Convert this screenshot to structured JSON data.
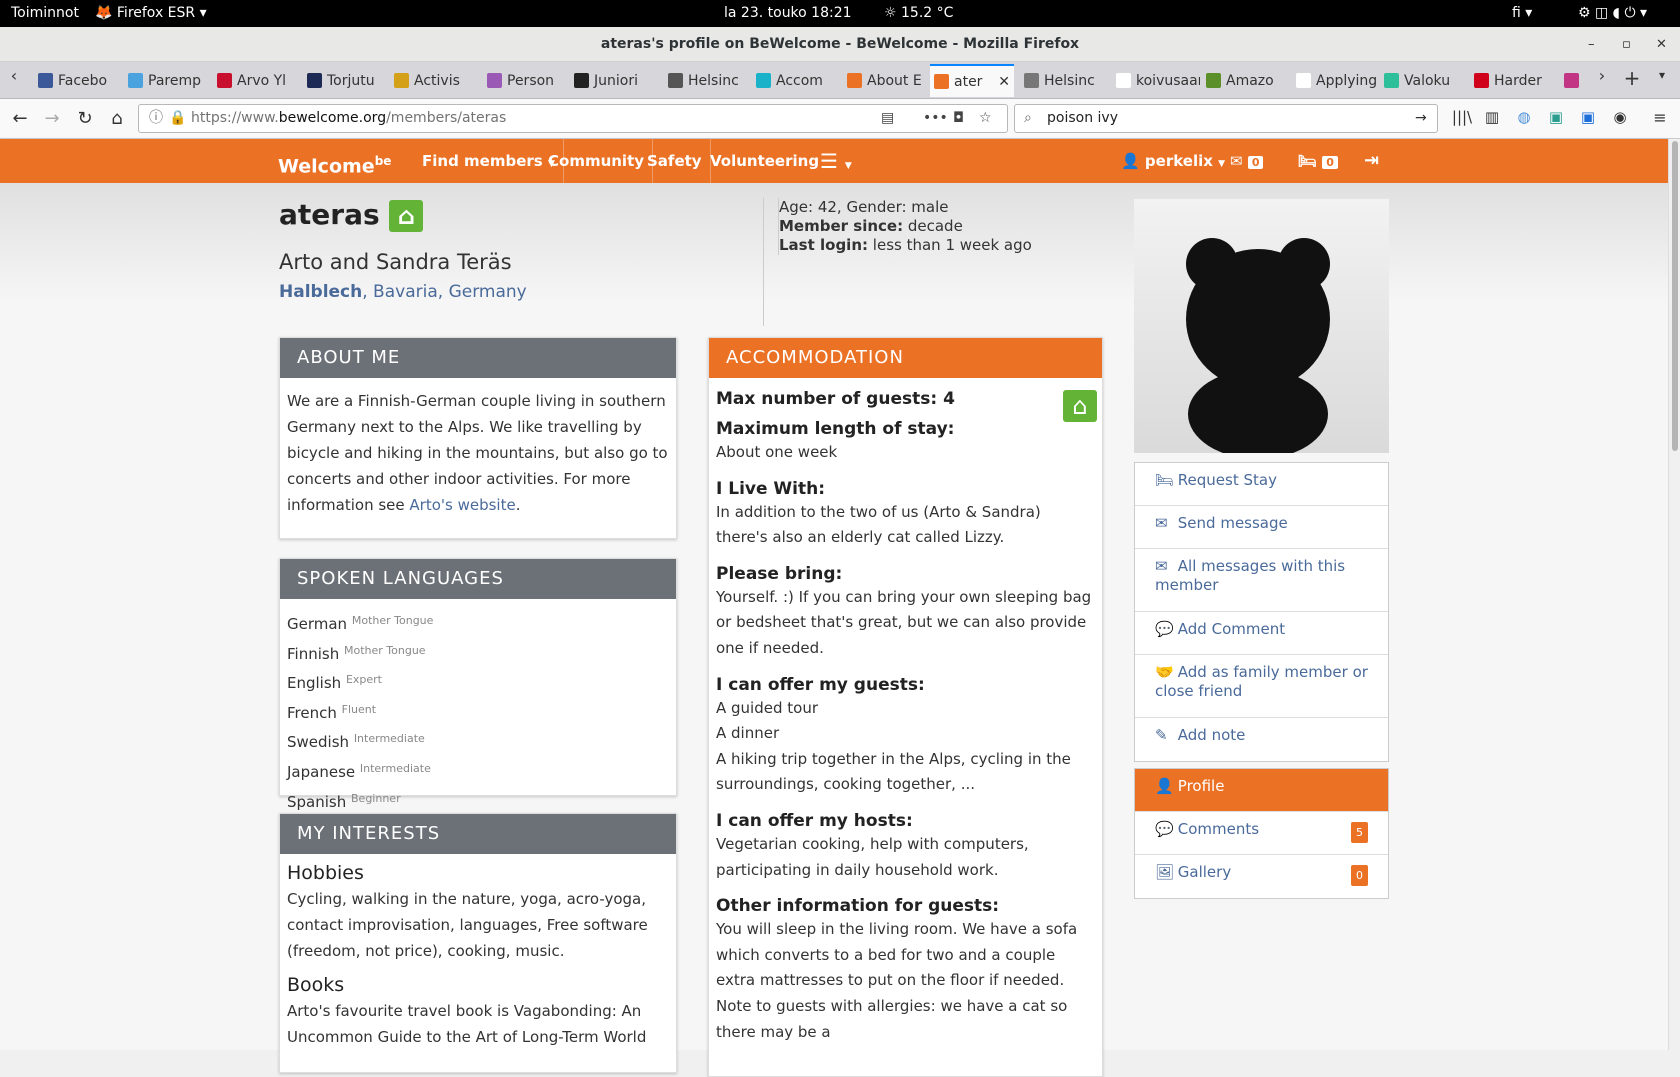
{
  "gnome": {
    "activities": "Toiminnot",
    "app": "Firefox ESR",
    "clock": "la 23. touko  18:21",
    "weather": "15.2 °C",
    "lang": "fi"
  },
  "window": {
    "title": "ateras's profile on BeWelcome - BeWelcome - Mozilla Firefox"
  },
  "tabs": [
    {
      "label": "Facebo",
      "color": "#3b5998"
    },
    {
      "label": "Paremp",
      "color": "#4aa3df"
    },
    {
      "label": "Arvo Yl",
      "color": "#c8102e"
    },
    {
      "label": "Torjutu",
      "color": "#1c2a55"
    },
    {
      "label": "Activis",
      "color": "#d4a017"
    },
    {
      "label": "Person",
      "color": "#9b59b6"
    },
    {
      "label": "Juniori",
      "color": "#222222"
    },
    {
      "label": "Helsinc",
      "color": "#555555"
    },
    {
      "label": "Accom",
      "color": "#1ab2c8"
    },
    {
      "label": "About E",
      "color": "#eb7125"
    },
    {
      "label": "ater",
      "color": "#eb7125"
    },
    {
      "label": "Helsinc",
      "color": "#777777"
    },
    {
      "label": "koivusaari",
      "color": "#ffffff"
    },
    {
      "label": "Amazo",
      "color": "#5a8f29"
    },
    {
      "label": "Applying A",
      "color": "#ffffff"
    },
    {
      "label": "Valoku",
      "color": "#2dbe9a"
    },
    {
      "label": "Harder",
      "color": "#d0021b"
    },
    {
      "label": "",
      "color": "#c13584"
    }
  ],
  "nav": {
    "url_prefix": "https://www.",
    "url_domain": "bewelcome.org",
    "url_path": "/members/ateras",
    "search": "poison ivy"
  },
  "site": {
    "logo": "Welcome",
    "logo_be": "be",
    "find": "Find members",
    "community": "Community",
    "safety": "Safety",
    "volunteering": "Volunteering",
    "user": "perkelix",
    "msg_count": "0",
    "req_count": "0"
  },
  "profile": {
    "username": "ateras",
    "fullname": "Arto and Sandra Teräs",
    "city": "Halblech",
    "region": "Bavaria",
    "country": "Germany",
    "age_gender": "Age: 42, Gender: male",
    "member_since_label": "Member since:",
    "member_since": "decade",
    "last_login_label": "Last login:",
    "last_login": "less than 1 week ago"
  },
  "about": {
    "title": "ABOUT ME",
    "text": "We are a Finnish-German couple living in southern Germany next to the Alps. We like travelling by bicycle and hiking in the mountains, but also go to concerts and other indoor activities. For more information see ",
    "link": "Arto's website",
    "tail": "."
  },
  "languages": {
    "title": "SPOKEN LANGUAGES",
    "items": [
      {
        "name": "German",
        "level": "Mother Tongue"
      },
      {
        "name": "Finnish",
        "level": "Mother Tongue"
      },
      {
        "name": "English",
        "level": "Expert"
      },
      {
        "name": "French",
        "level": "Fluent"
      },
      {
        "name": "Swedish",
        "level": "Intermediate"
      },
      {
        "name": "Japanese",
        "level": "Intermediate"
      },
      {
        "name": "Spanish",
        "level": "Beginner"
      }
    ]
  },
  "interests": {
    "title": "MY INTERESTS",
    "hobbies_h": "Hobbies",
    "hobbies": "Cycling, walking in the nature, yoga, acro-yoga, contact improvisation, languages, Free software (freedom, not price), cooking, music.",
    "books_h": "Books",
    "books": "Arto's favourite travel book is Vagabonding: An Uncommon Guide to the Art of Long-Term World"
  },
  "accommodation": {
    "title": "ACCOMMODATION",
    "max_guests": "Max number of guests: 4",
    "max_stay_h": "Maximum length of stay:",
    "max_stay": "About one week",
    "live_with_h": "I Live With:",
    "live_with": "In addition to the two of us (Arto & Sandra) there's also an elderly cat called Lizzy.",
    "bring_h": "Please bring:",
    "bring": "Yourself. :) If you can bring your own sleeping bag or bedsheet that's great, but we can also provide one if needed.",
    "offer_guests_h": "I can offer my guests:",
    "offer1": "A guided tour",
    "offer2": "A dinner",
    "offer3": "A hiking trip together in the Alps, cycling in the surroundings, cooking together, ...",
    "offer_hosts_h": "I can offer my hosts:",
    "offer_hosts": "Vegetarian cooking, help with computers, participating in daily household work.",
    "other_h": "Other information for guests:",
    "other": "You will sleep in the living room. We have a sofa which converts to a bed for two and a couple extra mattresses to put on the floor if needed. Note to guests with allergies: we have a cat so there may be a"
  },
  "actions": {
    "request": "Request Stay",
    "send": "Send message",
    "all_msgs": "All messages with this member",
    "comment": "Add Comment",
    "family": "Add as family member or close friend",
    "note": "Add note"
  },
  "menu": {
    "profile": "Profile",
    "comments": "Comments",
    "comments_count": "5",
    "gallery": "Gallery",
    "gallery_count": "0"
  }
}
